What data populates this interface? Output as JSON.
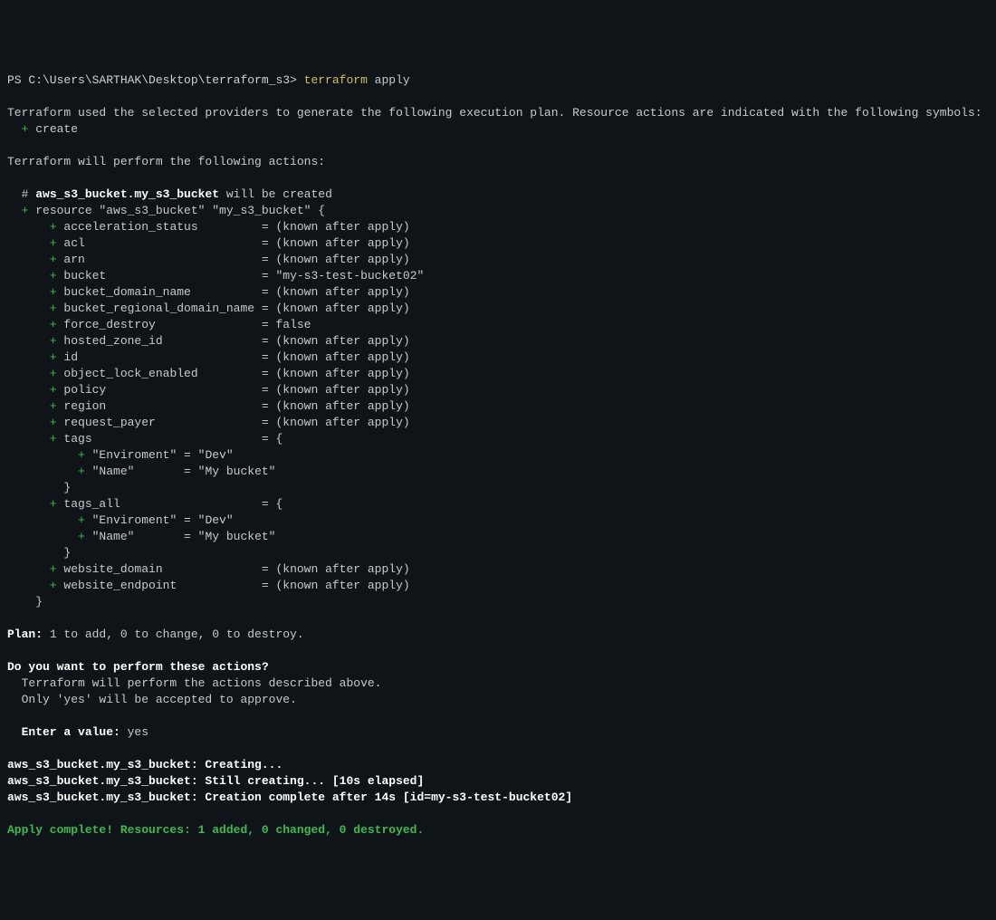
{
  "prompt": {
    "prefix": "PS C:\\Users\\SARTHAK\\Desktop\\terraform_s3> ",
    "cmd1": "terraform",
    "cmd2": " apply"
  },
  "intro": {
    "line1": "Terraform used the selected providers to generate the following execution plan. Resource actions are indicated with the following symbols:",
    "createSymbol": "  + ",
    "createText": "create"
  },
  "willPerform": "Terraform will perform the following actions:",
  "resourceHeader": {
    "indent": "  # ",
    "name": "aws_s3_bucket.my_s3_bucket",
    "suffix": " will be created"
  },
  "resourceDecl": {
    "indent": "  ",
    "plus": "+ ",
    "text": "resource \"aws_s3_bucket\" \"my_s3_bucket\" {"
  },
  "attrs": [
    {
      "plus": "      + ",
      "key": "acceleration_status        ",
      "eq": " = ",
      "val": "(known after apply)"
    },
    {
      "plus": "      + ",
      "key": "acl                        ",
      "eq": " = ",
      "val": "(known after apply)"
    },
    {
      "plus": "      + ",
      "key": "arn                        ",
      "eq": " = ",
      "val": "(known after apply)"
    },
    {
      "plus": "      + ",
      "key": "bucket                     ",
      "eq": " = ",
      "val": "\"my-s3-test-bucket02\""
    },
    {
      "plus": "      + ",
      "key": "bucket_domain_name         ",
      "eq": " = ",
      "val": "(known after apply)"
    },
    {
      "plus": "      + ",
      "key": "bucket_regional_domain_name",
      "eq": " = ",
      "val": "(known after apply)"
    },
    {
      "plus": "      + ",
      "key": "force_destroy              ",
      "eq": " = ",
      "val": "false"
    },
    {
      "plus": "      + ",
      "key": "hosted_zone_id             ",
      "eq": " = ",
      "val": "(known after apply)"
    },
    {
      "plus": "      + ",
      "key": "id                         ",
      "eq": " = ",
      "val": "(known after apply)"
    },
    {
      "plus": "      + ",
      "key": "object_lock_enabled        ",
      "eq": " = ",
      "val": "(known after apply)"
    },
    {
      "plus": "      + ",
      "key": "policy                     ",
      "eq": " = ",
      "val": "(known after apply)"
    },
    {
      "plus": "      + ",
      "key": "region                     ",
      "eq": " = ",
      "val": "(known after apply)"
    },
    {
      "plus": "      + ",
      "key": "request_payer              ",
      "eq": " = ",
      "val": "(known after apply)"
    }
  ],
  "tagsBlock": {
    "open": {
      "plus": "      + ",
      "key": "tags                       ",
      "eq": " = ",
      "val": "{"
    },
    "env": {
      "plus": "          + ",
      "key": "\"Enviroment\"",
      "pad": " = ",
      "val": "\"Dev\""
    },
    "name": {
      "plus": "          + ",
      "key": "\"Name\"      ",
      "pad": " = ",
      "val": "\"My bucket\""
    },
    "close": "        }"
  },
  "tagsAllBlock": {
    "open": {
      "plus": "      + ",
      "key": "tags_all                   ",
      "eq": " = ",
      "val": "{"
    },
    "env": {
      "plus": "          + ",
      "key": "\"Enviroment\"",
      "pad": " = ",
      "val": "\"Dev\""
    },
    "name": {
      "plus": "          + ",
      "key": "\"Name\"      ",
      "pad": " = ",
      "val": "\"My bucket\""
    },
    "close": "        }"
  },
  "trailingAttrs": [
    {
      "plus": "      + ",
      "key": "website_domain             ",
      "eq": " = ",
      "val": "(known after apply)"
    },
    {
      "plus": "      + ",
      "key": "website_endpoint           ",
      "eq": " = ",
      "val": "(known after apply)"
    }
  ],
  "closeBrace": "    }",
  "plan": {
    "label": "Plan:",
    "text": " 1 to add, 0 to change, 0 to destroy."
  },
  "confirm": {
    "question": "Do you want to perform these actions?",
    "line1": "  Terraform will perform the actions described above.",
    "line2": "  Only 'yes' will be accepted to approve.",
    "enterLabel": "  Enter a value: ",
    "enterValue": "yes"
  },
  "progress": {
    "line1": "aws_s3_bucket.my_s3_bucket: Creating...",
    "line2": "aws_s3_bucket.my_s3_bucket: Still creating... [10s elapsed]",
    "line3": "aws_s3_bucket.my_s3_bucket: Creation complete after 14s [id=my-s3-test-bucket02]"
  },
  "complete": "Apply complete! Resources: 1 added, 0 changed, 0 destroyed."
}
